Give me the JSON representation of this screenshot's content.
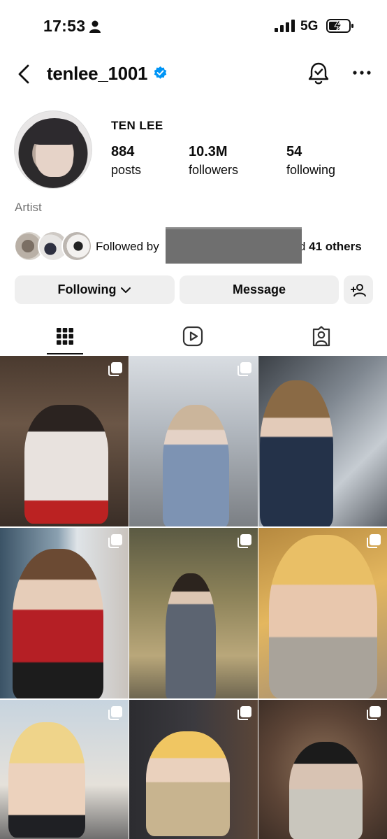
{
  "status_bar": {
    "time": "17:53",
    "network": "5G"
  },
  "header": {
    "username": "tenlee_1001"
  },
  "profile": {
    "display_name": "TEN LEE",
    "stats": [
      {
        "value": "884",
        "label": "posts"
      },
      {
        "value": "10.3M",
        "label": "followers"
      },
      {
        "value": "54",
        "label": "following"
      }
    ],
    "category": "Artist",
    "followed_by": {
      "prefix": "Followed by",
      "suffix_partial": "nd",
      "others": "41 others"
    }
  },
  "buttons": {
    "following": "Following",
    "message": "Message"
  },
  "tabs": [
    {
      "name": "posts-grid",
      "active": true
    },
    {
      "name": "reels",
      "active": false
    },
    {
      "name": "tagged",
      "active": false
    }
  ],
  "colors": {
    "verified": "#0095f6",
    "button_bg": "#efefef",
    "muted_text": "#737373"
  },
  "posts": [
    {
      "multi": true
    },
    {
      "multi": true
    },
    {
      "multi": false
    },
    {
      "multi": true
    },
    {
      "multi": true
    },
    {
      "multi": true
    },
    {
      "multi": true
    },
    {
      "multi": true
    },
    {
      "multi": true
    }
  ]
}
